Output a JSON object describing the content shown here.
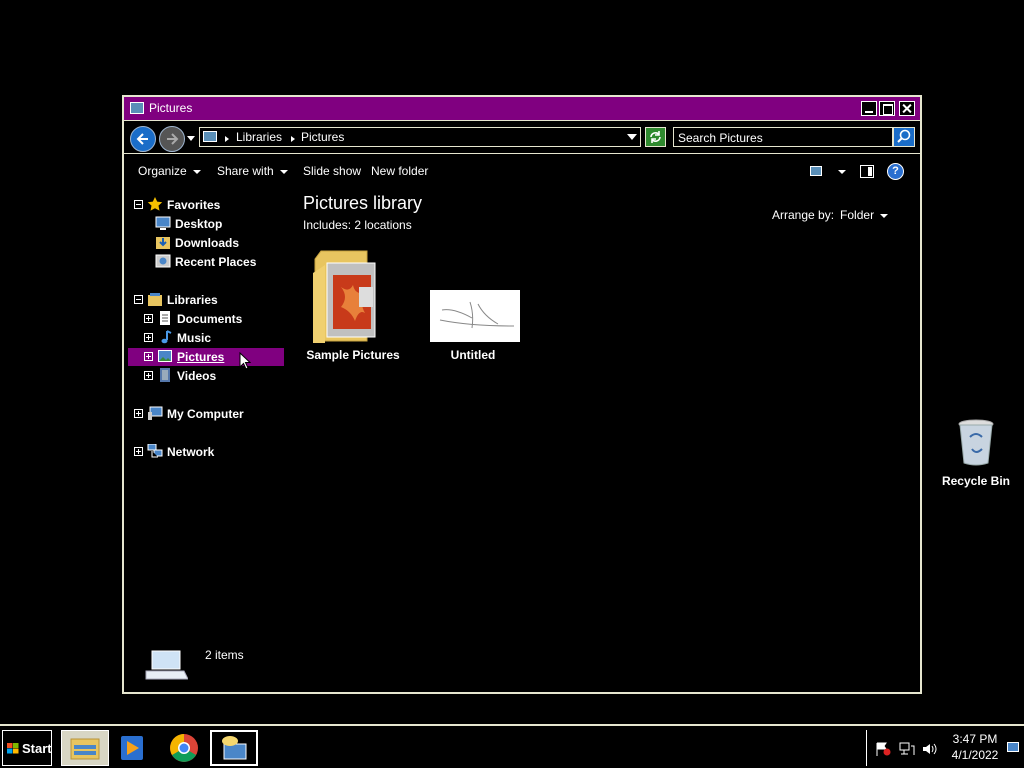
{
  "window": {
    "title": "Pictures",
    "breadcrumbs": [
      "Libraries",
      "Pictures"
    ],
    "search": {
      "placeholder": "Search Pictures",
      "value": "Search Pictures"
    }
  },
  "toolbar": {
    "organize": "Organize",
    "share_with": "Share with",
    "slide_show": "Slide show",
    "new_folder": "New folder"
  },
  "nav": {
    "favorites": "Favorites",
    "desktop": "Desktop",
    "downloads": "Downloads",
    "recent_places": "Recent Places",
    "libraries": "Libraries",
    "documents": "Documents",
    "music": "Music",
    "pictures": "Pictures",
    "videos": "Videos",
    "my_computer": "My Computer",
    "network": "Network",
    "selected": "pictures"
  },
  "content": {
    "title": "Pictures library",
    "includes": "Includes:  2 locations",
    "arrange_by_label": "Arrange by:",
    "arrange_by_value": "Folder",
    "items": [
      {
        "name": "Sample Pictures",
        "type": "folder"
      },
      {
        "name": "Untitled",
        "type": "image"
      }
    ]
  },
  "status": {
    "items_count": "2 items"
  },
  "desktop": {
    "recycle_bin": "Recycle Bin"
  },
  "taskbar": {
    "start": "Start",
    "apps": [
      "file-explorer",
      "media-player",
      "chrome",
      "remote-desktop"
    ],
    "time": "3:47 PM",
    "date": "4/1/2022"
  },
  "colors": {
    "accent": "#800080",
    "background": "#000000",
    "border": "#e6e6cf"
  }
}
